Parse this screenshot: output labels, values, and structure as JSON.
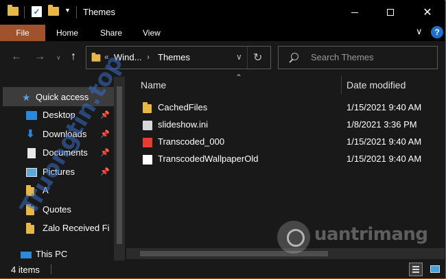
{
  "window": {
    "title": "Themes"
  },
  "ribbon": {
    "tabs": [
      "File",
      "Home",
      "Share",
      "View"
    ]
  },
  "address": {
    "crumbs": [
      "Wind...",
      "Themes"
    ],
    "overflow": "«"
  },
  "search": {
    "placeholder": "Search Themes"
  },
  "nav_pane": {
    "quick_access": "Quick access",
    "items": [
      {
        "label": "Desktop",
        "icon": "desktop-icon",
        "pinned": true
      },
      {
        "label": "Downloads",
        "icon": "download-icon",
        "pinned": true
      },
      {
        "label": "Documents",
        "icon": "document-icon",
        "pinned": true
      },
      {
        "label": "Pictures",
        "icon": "pictures-icon",
        "pinned": true
      },
      {
        "label": "A",
        "icon": "folder-icon",
        "pinned": false
      },
      {
        "label": "Quotes",
        "icon": "folder-icon",
        "pinned": false
      },
      {
        "label": "Zalo Received Fi",
        "icon": "folder-icon",
        "pinned": false
      },
      {
        "label": "This PC",
        "icon": "pc-icon",
        "pinned": false
      }
    ]
  },
  "columns": {
    "name": "Name",
    "date": "Date modified"
  },
  "files": [
    {
      "name": "CachedFiles",
      "date": "1/15/2021 9:40 AM",
      "icon": "folder-icon"
    },
    {
      "name": "slideshow.ini",
      "date": "1/8/2021 3:36 PM",
      "icon": "ini-file-icon"
    },
    {
      "name": "Transcoded_000",
      "date": "1/15/2021 9:40 AM",
      "icon": "image-file-icon"
    },
    {
      "name": "TranscodedWallpaperOld",
      "date": "1/15/2021 9:40 AM",
      "icon": "file-icon"
    }
  ],
  "status": {
    "count": "4 items"
  },
  "watermark": {
    "left": "Truongtin.top",
    "right": "uantrimang"
  },
  "colors": {
    "accent": "#a0522d",
    "background": "#191919",
    "selection": "#3c3c3c",
    "help": "#1e70c8"
  }
}
